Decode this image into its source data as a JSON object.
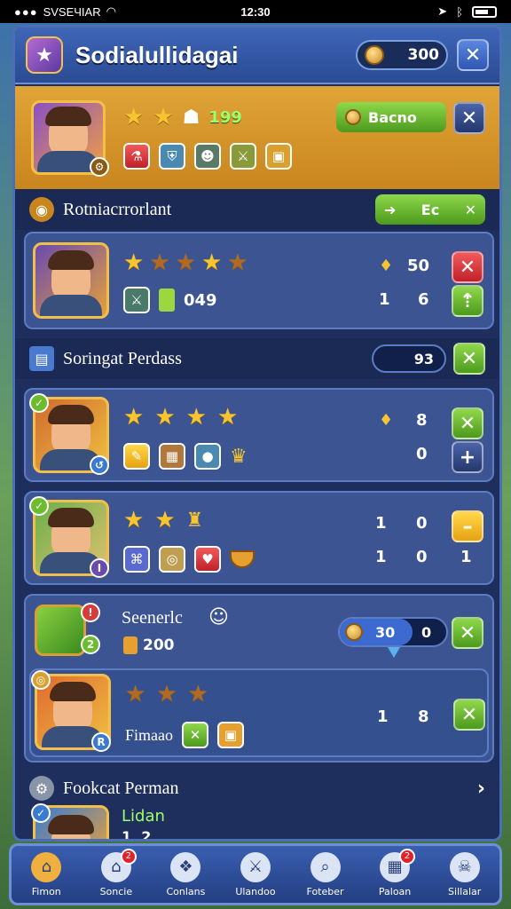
{
  "status": {
    "carrier": "SVSEЧIAR",
    "time": "12:30"
  },
  "header": {
    "title": "Sodialullidagai",
    "coins": "300"
  },
  "hero": {
    "level": "199",
    "action_label": "Bacno"
  },
  "section1": {
    "title": "Rotniacrrorlant",
    "button_label": "Ec"
  },
  "card1": {
    "val_a": "50",
    "val_b": "1",
    "val_c": "6",
    "count": "049"
  },
  "section2": {
    "title": "Soringat Perdass",
    "value": "93"
  },
  "card2": {
    "val_a": "8",
    "val_b": "0"
  },
  "card3": {
    "val_a": "1",
    "val_b": "0",
    "val_c": "1",
    "val_d": "0",
    "val_e": "1"
  },
  "card4": {
    "name": "Seenerlc",
    "amount": "200",
    "pill_value": "30",
    "pill_value_b": "0"
  },
  "card5": {
    "name": "Fimaao",
    "val_a": "1",
    "val_b": "8"
  },
  "section3": {
    "title": "Fookcat Perman"
  },
  "card6": {
    "name": "Lidan",
    "val_a": "1",
    "val_b": "2"
  },
  "nav": [
    {
      "label": "Fimon",
      "icon": "home-icon",
      "badge": ""
    },
    {
      "label": "Soncie",
      "icon": "house-icon",
      "badge": "2"
    },
    {
      "label": "Conlans",
      "icon": "paw-icon",
      "badge": ""
    },
    {
      "label": "Ulandoo",
      "icon": "sword-icon",
      "badge": ""
    },
    {
      "label": "Foteber",
      "icon": "magnify-icon",
      "badge": ""
    },
    {
      "label": "Paloan",
      "icon": "map-icon",
      "badge": "2"
    },
    {
      "label": "Sillalar",
      "icon": "skull-icon",
      "badge": ""
    }
  ],
  "colors": {
    "panel": "#1e2f5e",
    "hero": "#d9962c",
    "green_btn": "#6cbd2e",
    "red_btn": "#d93a3a"
  }
}
